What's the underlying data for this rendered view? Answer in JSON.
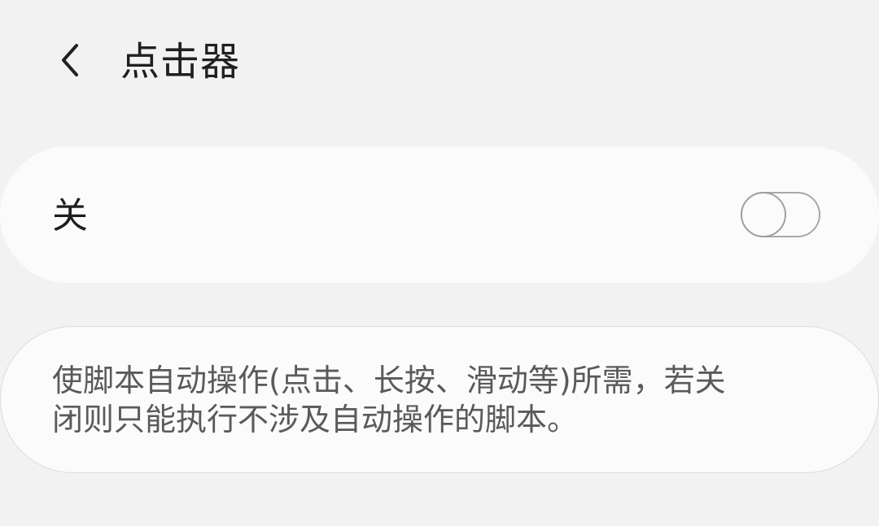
{
  "header": {
    "back_icon": "chevron-left-icon",
    "title": "点击器"
  },
  "toggle_card": {
    "label": "关",
    "switch_state": "off",
    "switch_colors": {
      "track_border": "#a8a8a8",
      "thumb_border": "#a0a0a0"
    }
  },
  "description_card": {
    "text": "使脚本自动操作(点击、长按、滑动等)所需，若关\n闭则只能执行不涉及自动操作的脚本。"
  },
  "colors": {
    "background": "#f2f2f2",
    "card": "#fbfbfb",
    "title_text": "#202020",
    "description_text": "#5a5a5a"
  }
}
